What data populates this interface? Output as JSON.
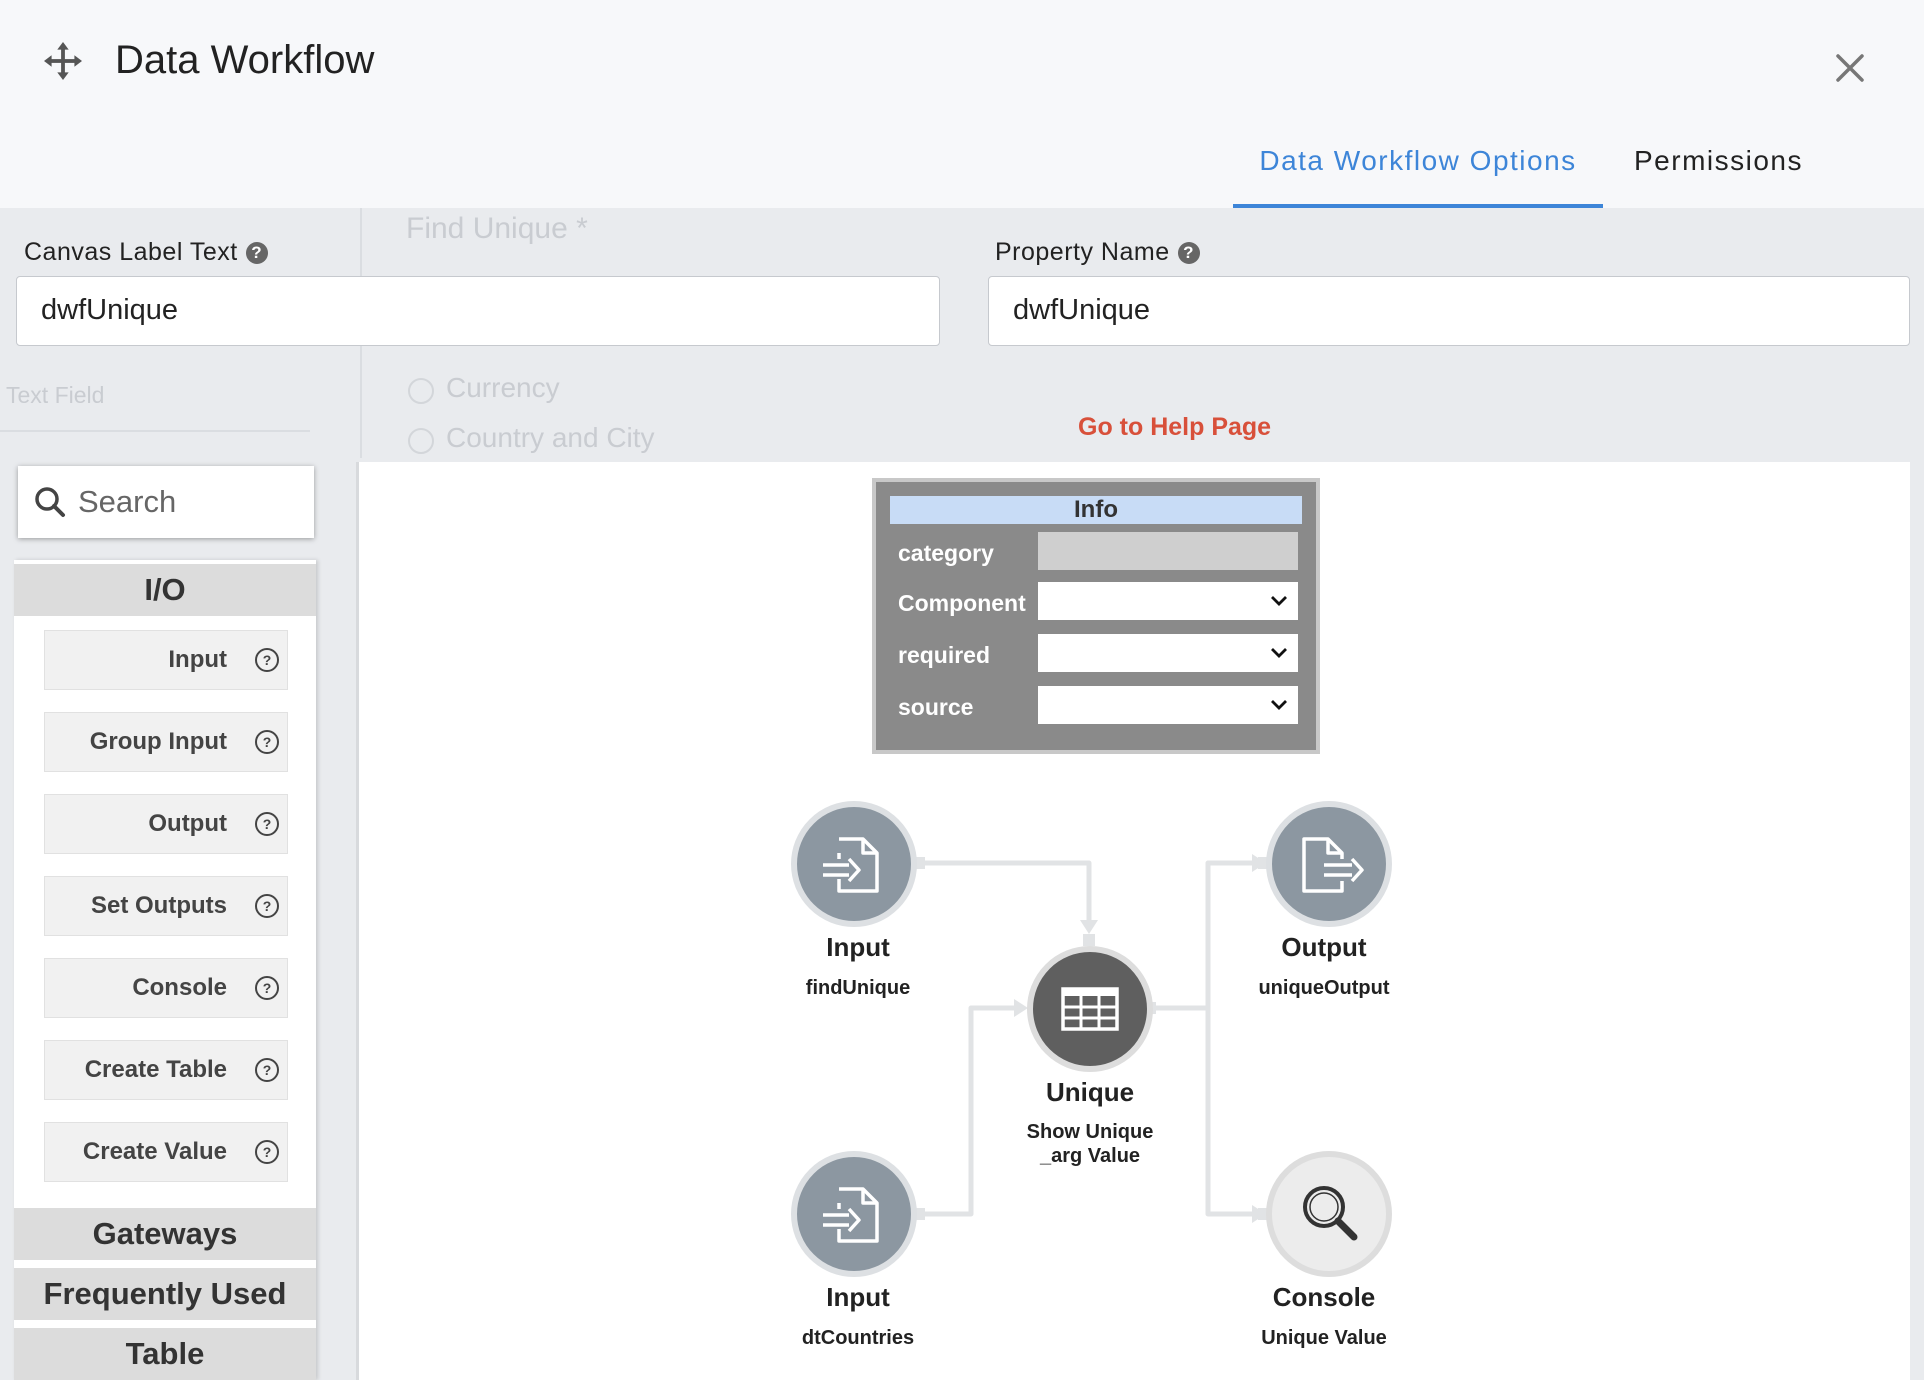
{
  "background": {
    "ghost_title": "Find Unique *",
    "ghost_currency": "Currency",
    "ghost_country": "Country and City",
    "ghost_textfield": "Text Field"
  },
  "header": {
    "title": "Data Workflow",
    "tabs": [
      {
        "label": "Data Workflow Options",
        "active": true
      },
      {
        "label": "Permissions",
        "active": false
      }
    ]
  },
  "form": {
    "canvas_label_text": {
      "label": "Canvas Label Text",
      "value": "dwfUnique"
    },
    "property_name": {
      "label": "Property Name",
      "value": "dwfUnique"
    },
    "help_link": "Go to Help Page"
  },
  "sidebar": {
    "search_placeholder": "Search",
    "category_io": "I/O",
    "items": [
      {
        "label": "Input"
      },
      {
        "label": "Group Input"
      },
      {
        "label": "Output"
      },
      {
        "label": "Set Outputs"
      },
      {
        "label": "Console"
      },
      {
        "label": "Create Table"
      },
      {
        "label": "Create Value"
      }
    ],
    "categories": [
      "Gateways",
      "Frequently Used",
      "Table"
    ]
  },
  "info_panel": {
    "header": "Info",
    "rows": [
      "category",
      "Component",
      "required",
      "source"
    ]
  },
  "nodes": [
    {
      "title": "Input",
      "subtitle": "findUnique"
    },
    {
      "title": "Unique",
      "subtitle": "Show Unique _arg Value"
    },
    {
      "title": "Output",
      "subtitle": "uniqueOutput"
    },
    {
      "title": "Input",
      "subtitle": "dtCountries"
    },
    {
      "title": "Console",
      "subtitle": "Unique Value"
    }
  ],
  "colors": {
    "accent": "#3d85d8",
    "help_link": "#d8503a",
    "info_header": "#c8dcf6",
    "node_light": "#8c97a1",
    "node_dark": "#5f5f5f"
  }
}
